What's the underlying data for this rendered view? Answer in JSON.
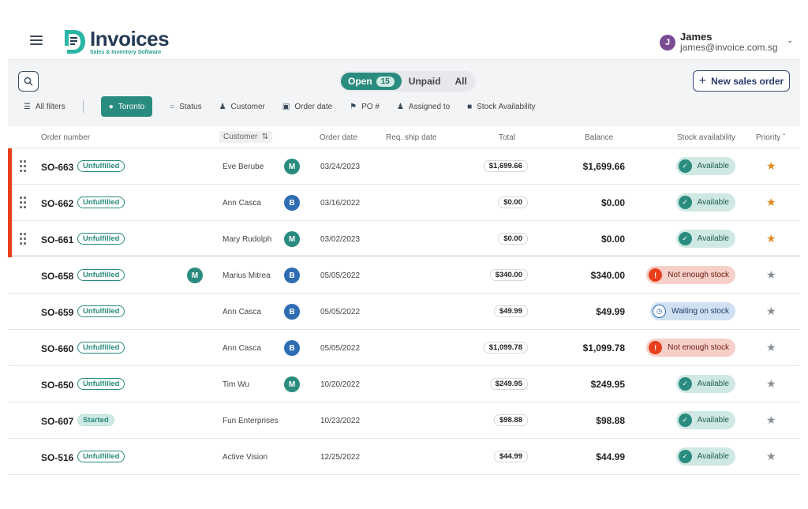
{
  "app": {
    "logo_title": "Invoices",
    "logo_subtitle": "Sales & Inventory Software"
  },
  "user": {
    "initial": "J",
    "name": "James",
    "email": "james@invoice.com.sg"
  },
  "toolbar": {
    "segments": [
      {
        "label": "Open",
        "count": "15",
        "active": true
      },
      {
        "label": "Unpaid",
        "active": false
      },
      {
        "label": "All",
        "active": false
      }
    ],
    "new_order_label": "New sales order",
    "filters": {
      "all": "All filters",
      "toronto": "Toronto",
      "status": "Status",
      "customer": "Customer",
      "order_date": "Order date",
      "po": "PO #",
      "assigned": "Assigned to",
      "stock": "Stock Availability"
    }
  },
  "table": {
    "columns": {
      "order_number": "Order number",
      "customer": "Customer",
      "order_date": "Order date",
      "req_ship": "Req. ship date",
      "total": "Total",
      "balance": "Balance",
      "stock": "Stock availability",
      "priority": "Priority"
    },
    "rows": [
      {
        "order": "SO-663",
        "status": "Unfulfilled",
        "customer": "Eve Berube",
        "badge": "M",
        "date": "03/24/2023",
        "total": "$1,699.66",
        "balance": "$1,699.66",
        "stock": "Available",
        "priority": true
      },
      {
        "order": "SO-662",
        "status": "Unfulfilled",
        "customer": "Ann Casca",
        "badge": "B",
        "date": "03/16/2022",
        "total": "$0.00",
        "balance": "$0.00",
        "stock": "Available",
        "priority": true
      },
      {
        "order": "SO-661",
        "status": "Unfulfilled",
        "customer": "Mary Rudolph",
        "badge": "M",
        "date": "03/02/2023",
        "total": "$0.00",
        "balance": "$0.00",
        "stock": "Available",
        "priority": true
      },
      {
        "order": "SO-658",
        "status": "Unfulfilled",
        "customer": "Marius Mitrea",
        "badge": "B",
        "extra_badge": "M",
        "date": "05/05/2022",
        "total": "$340.00",
        "balance": "$340.00",
        "stock": "Not enough stock",
        "priority": false
      },
      {
        "order": "SO-659",
        "status": "Unfulfilled",
        "customer": "Ann Casca",
        "badge": "B",
        "date": "05/05/2022",
        "total": "$49.99",
        "balance": "$49.99",
        "stock": "Waiting on stock",
        "priority": false
      },
      {
        "order": "SO-660",
        "status": "Unfulfilled",
        "customer": "Ann Casca",
        "badge": "B",
        "date": "05/05/2022",
        "total": "$1,099.78",
        "balance": "$1,099.78",
        "stock": "Not enough stock",
        "priority": false
      },
      {
        "order": "SO-650",
        "status": "Unfulfilled",
        "customer": "Tim Wu",
        "badge": "M",
        "date": "10/20/2022",
        "total": "$249.95",
        "balance": "$249.95",
        "stock": "Available",
        "priority": false
      },
      {
        "order": "SO-607",
        "status": "Started",
        "customer": "Fun Enterprises",
        "date": "10/23/2022",
        "total": "$98.88",
        "balance": "$98.88",
        "stock": "Available",
        "priority": false
      },
      {
        "order": "SO-516",
        "status": "Unfulfilled",
        "customer": "Active Vision",
        "date": "12/25/2022",
        "total": "$44.99",
        "balance": "$44.99",
        "stock": "Available",
        "priority": false
      }
    ]
  },
  "colors": {
    "accent": "#2a8c7e",
    "flag": "#e8401c",
    "star_on": "#e08a1e"
  }
}
